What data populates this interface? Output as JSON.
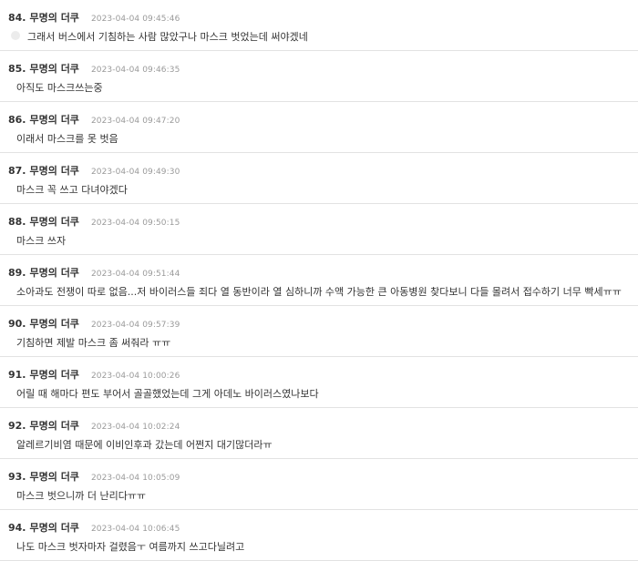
{
  "comments": [
    {
      "num": "84.",
      "nick": "무명의 더쿠",
      "date": "2023-04-04 09:45:46",
      "text": "그래서 버스에서 기침하는 사람 많았구나 마스크 벗었는데 써야겠네"
    },
    {
      "num": "85.",
      "nick": "무명의 더쿠",
      "date": "2023-04-04 09:46:35",
      "text": "아직도 마스크쓰는중"
    },
    {
      "num": "86.",
      "nick": "무명의 더쿠",
      "date": "2023-04-04 09:47:20",
      "text": "이래서 마스크를 못 벗음"
    },
    {
      "num": "87.",
      "nick": "무명의 더쿠",
      "date": "2023-04-04 09:49:30",
      "text": "마스크 꼭 쓰고 다녀야겠다"
    },
    {
      "num": "88.",
      "nick": "무명의 더쿠",
      "date": "2023-04-04 09:50:15",
      "text": "마스크 쓰자"
    },
    {
      "num": "89.",
      "nick": "무명의 더쿠",
      "date": "2023-04-04 09:51:44",
      "text": "소아과도 전쟁이 따로 없음...저 바이러스들 죄다 열 동반이라 열 심하니까 수액 가능한 큰 아동병원 찾다보니 다들 몰려서 접수하기 너무 빡세ㅠㅠ"
    },
    {
      "num": "90.",
      "nick": "무명의 더쿠",
      "date": "2023-04-04 09:57:39",
      "text": "기침하면 제발 마스크 좀 써줘라 ㅠㅠ"
    },
    {
      "num": "91.",
      "nick": "무명의 더쿠",
      "date": "2023-04-04 10:00:26",
      "text": "어릴 때 해마다 편도 부어서 골골했었는데 그게 아데노 바이러스였나보다"
    },
    {
      "num": "92.",
      "nick": "무명의 더쿠",
      "date": "2023-04-04 10:02:24",
      "text": "알레르기비염 때문에 이비인후과 갔는데 어쩐지 대기많더라ㅠ"
    },
    {
      "num": "93.",
      "nick": "무명의 더쿠",
      "date": "2023-04-04 10:05:09",
      "text": "마스크 벗으니까 더 난리다ㅠㅠ"
    },
    {
      "num": "94.",
      "nick": "무명의 더쿠",
      "date": "2023-04-04 10:06:45",
      "text": "나도 마스크 벗자마자 걸렸음ㅜ 여름까지 쓰고다닐려고"
    }
  ]
}
